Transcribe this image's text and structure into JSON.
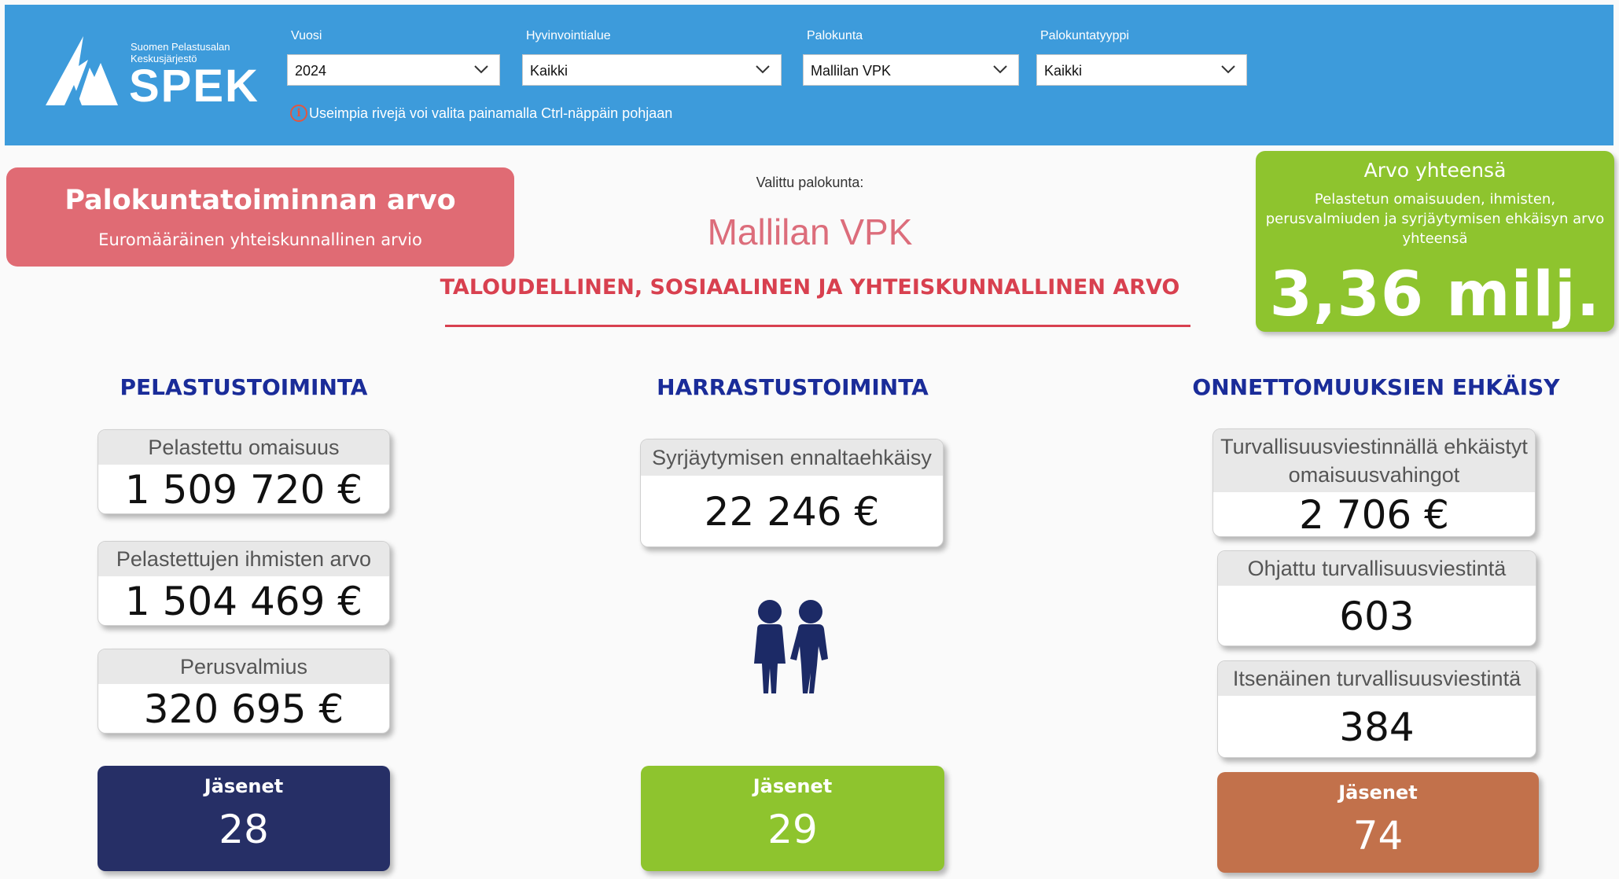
{
  "header": {
    "logo_line1": "Suomen Pelastusalan",
    "logo_line2": "Keskusjärjestö",
    "logo_brand": "SPEK",
    "filters": [
      {
        "label": "Vuosi",
        "value": "2024"
      },
      {
        "label": "Hyvinvointialue",
        "value": "Kaikki"
      },
      {
        "label": "Palokunta",
        "value": "Mallilan VPK"
      },
      {
        "label": "Palokuntatyyppi",
        "value": "Kaikki"
      }
    ],
    "hint_icon": "i",
    "hint": "Useimpia rivejä voi valita painamalla Ctrl-näppäin pohjaan"
  },
  "summary": {
    "title": "Palokuntatoiminnan arvo",
    "subtitle": "Euromääräinen yhteiskunnallinen arvio",
    "selected_label": "Valittu palokunta:",
    "selected_value": "Mallilan VPK",
    "value_heading": "TALOUDELLINEN, SOSIAALINEN JA YHTEISKUNNALLINEN ARVO"
  },
  "total": {
    "title": "Arvo yhteensä",
    "description": "Pelastetun omaisuuden, ihmisten, perusvalmiuden ja syrjäytymisen ehkäisyn arvo yhteensä",
    "value": "3,36 milj."
  },
  "sections": {
    "rescue": {
      "title": "PELASTUSTOIMINTA",
      "metrics": [
        {
          "label": "Pelastettu omaisuus",
          "value": "1 509 720 €"
        },
        {
          "label": "Pelastettujen ihmisten arvo",
          "value": "1 504 469 €"
        },
        {
          "label": "Perusvalmius",
          "value": "320 695 €"
        }
      ],
      "members_label": "Jäsenet",
      "members_value": "28"
    },
    "hobby": {
      "title": "HARRASTUSTOIMINTA",
      "metrics": [
        {
          "label": "Syrjäytymisen ennaltaehkäisy",
          "value": "22 246 €"
        }
      ],
      "members_label": "Jäsenet",
      "members_value": "29"
    },
    "prevention": {
      "title": "ONNETTOMUUKSIEN EHKÄISY",
      "metrics": [
        {
          "label": "Turvallisuusviestinnällä ehkäistyt omaisuusvahingot",
          "value": "2 706 €"
        },
        {
          "label": "Ohjattu turvallisuusviestintä",
          "value": "603"
        },
        {
          "label": "Itsenäinen turvallisuusviestintä",
          "value": "384"
        }
      ],
      "members_label": "Jäsenet",
      "members_value": "74"
    }
  },
  "colors": {
    "header_bg": "#3d9bdb",
    "summary_red": "#e06b74",
    "total_green": "#8ec42e",
    "rescue_members": "#262f66",
    "hobby_members": "#8ec42e",
    "prevention_members": "#c2714b",
    "section_title": "#1a2c99",
    "icon_navy": "#1c2a66"
  }
}
